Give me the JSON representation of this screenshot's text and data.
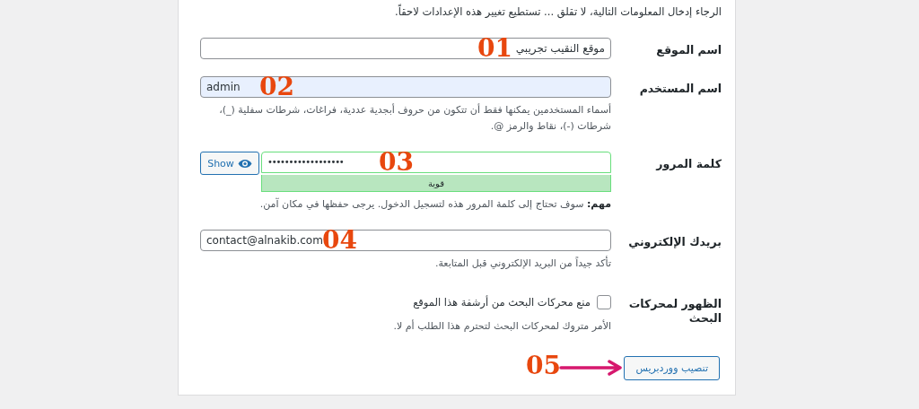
{
  "intro": "الرجاء إدخال المعلومات التالية، لا تقلق ... تستطيع تغيير هذه الإعدادات لاحقاً.",
  "fields": [
    {
      "kind": "text",
      "label": "اسم الموقع",
      "value": "موقع النقيب تجريبي",
      "autofilled": false,
      "marker": "01"
    },
    {
      "kind": "text",
      "label": "اسم المستخدم",
      "value": "admin",
      "autofilled": true,
      "marker": "02",
      "hint": "أسماء المستخدمين يمكنها فقط أن تتكون من حروف أبجدية عددية، فراغات، شرطات سفلية (_)، شرطات (-)، نقاط والرمز @."
    },
    {
      "kind": "password",
      "label": "كلمة المرور",
      "value": "••••••••••••••••••",
      "autofilled": false,
      "marker": "03",
      "show_button": "Show",
      "strength": "قوية",
      "hint": "**مهم:** سوف تحتاج إلى كلمة المرور هذه لتسجيل الدخول. يرجى حفظها في مكان آمن."
    },
    {
      "kind": "text",
      "label": "بريدك الإلكتروني",
      "value": "contact@alnakib.com",
      "autofilled": false,
      "marker": "04",
      "hint": "تأكد جيداً من البريد الإلكتروني قبل المتابعة."
    },
    {
      "kind": "checkbox",
      "label": "الظهور لمحركات البحث",
      "option": "منع محركات البحث من أرشفة هذا الموقع",
      "checked": false,
      "hint": "الأمر متروك لمحركات البحث لتحترم هذا الطلب أم لا."
    }
  ],
  "submit": {
    "label": "تنصيب ووردبريس",
    "marker": "05"
  }
}
